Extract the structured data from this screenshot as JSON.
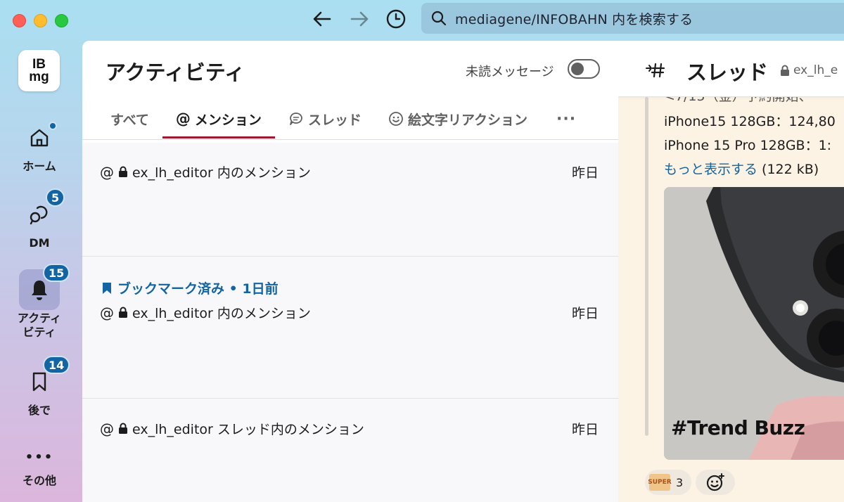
{
  "topbar": {
    "search_text": "mediagene/INFOBAHN 内を検索する"
  },
  "workspace": {
    "logo_line1": "IB",
    "logo_line2": "mg"
  },
  "rail": {
    "home_label": "ホーム",
    "dm_label": "DM",
    "dm_badge": "5",
    "activity_label": "アクティ\nビティ",
    "activity_badge": "15",
    "later_label": "後で",
    "later_badge": "14",
    "more_dots": "•••",
    "more_label": "その他"
  },
  "activity": {
    "title": "アクティビティ",
    "unread_label": "未読メッセージ",
    "unread_toggle": "off",
    "tabs": [
      {
        "label": "すべて",
        "icon": ""
      },
      {
        "label": "メンション",
        "icon": "@"
      },
      {
        "label": "スレッド",
        "icon": "thread-icon"
      },
      {
        "label": "絵文字リアクション",
        "icon": "smiley-icon"
      }
    ],
    "tabs_more": "···",
    "items": [
      {
        "at": "@",
        "text": "ex_lh_editor 内のメンション",
        "time": "昨日"
      },
      {
        "bookmark": "ブックマーク済み • 1日前",
        "at": "@",
        "text": "ex_lh_editor 内のメンション",
        "time": "昨日"
      },
      {
        "at": "@",
        "text": "ex_lh_editor スレッド内のメンション",
        "time": "昨日"
      }
    ]
  },
  "thread": {
    "title": "スレッド",
    "channel": "ex_lh_e",
    "line_cut": "<7/15（金）予約開始、",
    "line1": "iPhone15 128GB：124,80",
    "line2": "iPhone 15 Pro 128GB：1:",
    "more_link": "もっと表示する",
    "more_size": " (122 kB)",
    "image_caption": "#Trend Buzz",
    "reaction_label": "SUPER",
    "reaction_count": "3"
  }
}
